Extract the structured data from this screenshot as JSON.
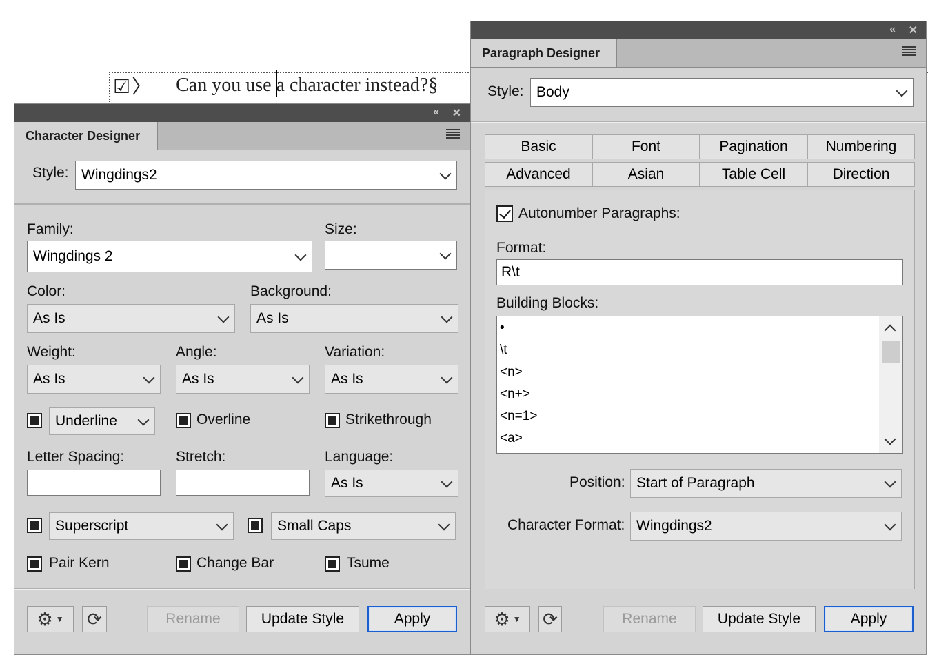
{
  "document": {
    "marker": "☑〉",
    "text": "Can you use a character instead?§"
  },
  "character_designer": {
    "tab_title": "Character Designer",
    "style_label": "Style:",
    "style_value": "Wingdings2",
    "family_label": "Family:",
    "family_value": "Wingdings 2",
    "size_label": "Size:",
    "size_value": "",
    "color_label": "Color:",
    "color_value": "As Is",
    "background_label": "Background:",
    "background_value": "As Is",
    "weight_label": "Weight:",
    "weight_value": "As Is",
    "angle_label": "Angle:",
    "angle_value": "As Is",
    "variation_label": "Variation:",
    "variation_value": "As Is",
    "underline_value": "Underline",
    "overline_label": "Overline",
    "strikethrough_label": "Strikethrough",
    "letter_spacing_label": "Letter Spacing:",
    "letter_spacing_value": "",
    "stretch_label": "Stretch:",
    "stretch_value": "",
    "language_label": "Language:",
    "language_value": "As Is",
    "superscript_value": "Superscript",
    "small_caps_value": "Small Caps",
    "pair_kern_label": "Pair Kern",
    "change_bar_label": "Change Bar",
    "tsume_label": "Tsume",
    "rename_label": "Rename",
    "update_style_label": "Update Style",
    "apply_label": "Apply"
  },
  "paragraph_designer": {
    "tab_title": "Paragraph Designer",
    "style_label": "Style:",
    "style_value": "Body",
    "tabs": [
      "Basic",
      "Font",
      "Pagination",
      "Numbering",
      "Advanced",
      "Asian",
      "Table Cell",
      "Direction"
    ],
    "autonumber_label": "Autonumber Paragraphs:",
    "format_label": "Format:",
    "format_value": "R\\t",
    "building_blocks_label": "Building Blocks:",
    "building_blocks": [
      "•",
      "\\t",
      "<n>",
      "<n+>",
      "<n=1>",
      "<a>"
    ],
    "position_label": "Position:",
    "position_value": "Start of Paragraph",
    "char_format_label": "Character Format:",
    "char_format_value": "Wingdings2",
    "rename_label": "Rename",
    "update_style_label": "Update Style",
    "apply_label": "Apply"
  },
  "icons": {
    "collapse": "«",
    "close": "✕",
    "gear": "⚙",
    "refresh": "⟳"
  },
  "colors": {
    "titlebar": "#4d4d4d",
    "panel_bg": "#d4d4d4",
    "primary_button_border": "#1b5fcf"
  }
}
